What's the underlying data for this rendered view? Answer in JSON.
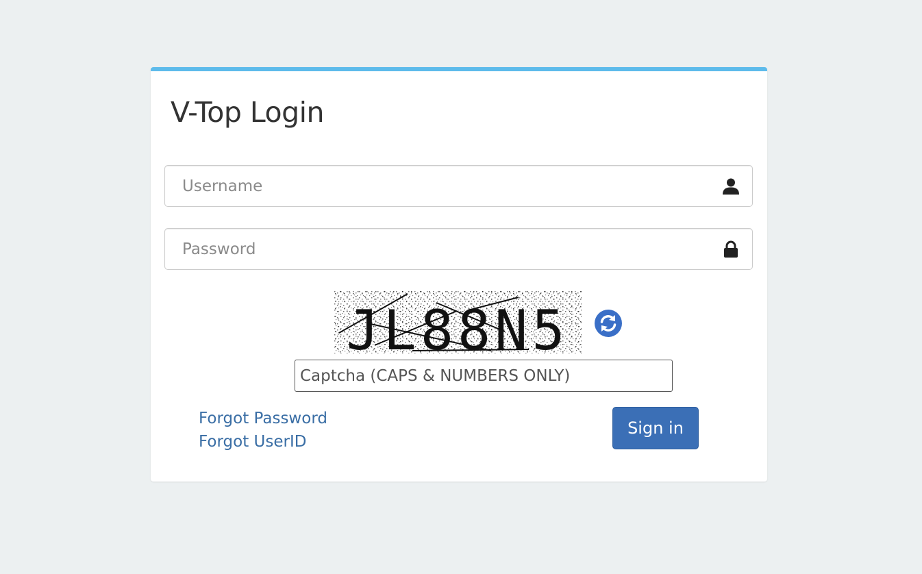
{
  "login": {
    "title": "V-Top Login",
    "username_placeholder": "Username",
    "password_placeholder": "Password",
    "captcha_text": "JL88N5",
    "captcha_placeholder": "Captcha (CAPS & NUMBERS ONLY)",
    "forgot_password": "Forgot Password",
    "forgot_userid": "Forgot UserID",
    "signin_label": "Sign in"
  },
  "icons": {
    "username": "user-icon",
    "password": "lock-icon",
    "refresh": "refresh-icon"
  },
  "colors": {
    "accent_bar": "#5dbbeb",
    "primary_button": "#3b6fb6",
    "link": "#3a6ea5",
    "refresh_icon": "#3a6fc7",
    "page_bg": "#ecf0f1"
  }
}
